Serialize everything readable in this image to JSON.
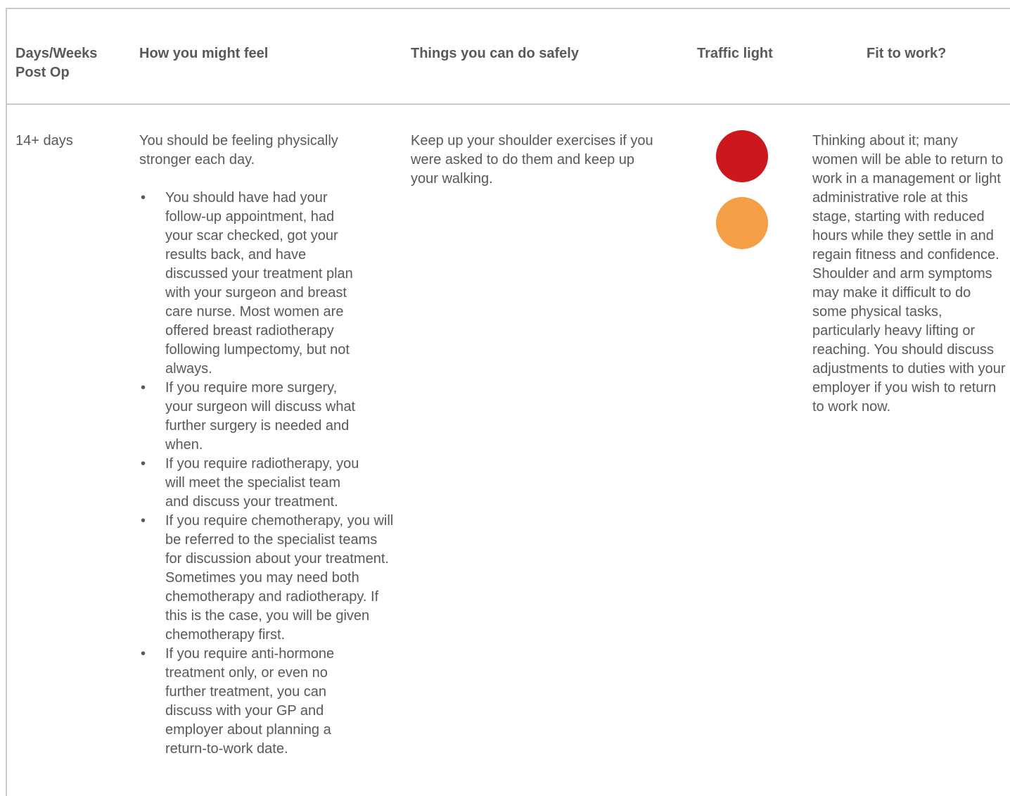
{
  "table": {
    "headers": {
      "days": "Days/Weeks Post Op",
      "feel": "How you might feel",
      "safe": "Things you can do safely",
      "light": "Traffic light",
      "work": "Fit to work?"
    },
    "row": {
      "days": "14+ days",
      "feel_intro": "You should be feeling physically stronger each day.",
      "bullets": [
        "You should have had your follow-up appointment, had your scar checked, got your results back, and have discussed your treatment plan with your surgeon and breast care nurse. Most women are offered breast radiotherapy following lumpectomy, but not always.",
        "If you require more surgery, your surgeon will discuss what further surgery is needed and when.",
        "If you require radiotherapy, you will meet the specialist team and discuss your treatment.",
        "If you require chemotherapy, you will be referred to the specialist teams for discussion about your treatment. Sometimes you may need both chemotherapy and radiotherapy. If this is the case, you will be given chemotherapy first.",
        "If you require anti-hormone treatment only, or even no further treatment, you can discuss with your GP and employer about planning a return-to-work date."
      ],
      "safe": "Keep up your shoulder exercises if you were asked to do them and keep up your walking.",
      "traffic_lights": [
        {
          "name": "red",
          "color": "#cc171c"
        },
        {
          "name": "amber",
          "color": "#f49f45"
        }
      ],
      "work": "Thinking about it; many women will be able to return to work in a management or light administrative role at this stage, starting with reduced hours while they settle in and regain fitness and confidence. Shoulder and arm symptoms may make it difficult to do some physical tasks, particularly heavy lifting or reaching. You should discuss adjustments to duties with your employer if you wish to return to work now."
    }
  }
}
